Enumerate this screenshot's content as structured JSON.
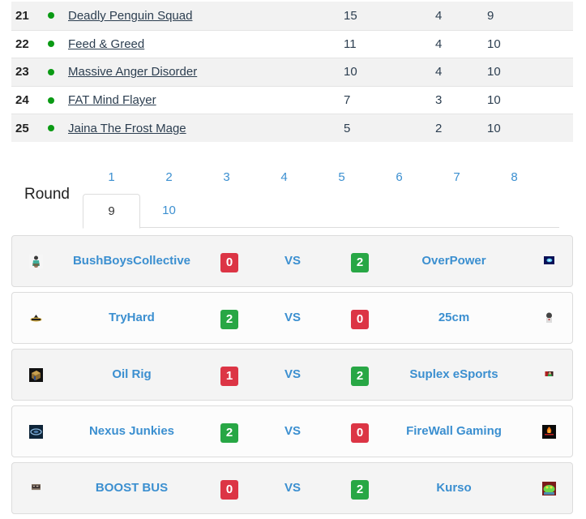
{
  "standings": {
    "rows": [
      {
        "rank": "21",
        "status": "active",
        "team": "Deadly Penguin Squad",
        "col1": "15",
        "col2": "4",
        "col3": "9"
      },
      {
        "rank": "22",
        "status": "active",
        "team": "Feed & Greed",
        "col1": "11",
        "col2": "4",
        "col3": "10"
      },
      {
        "rank": "23",
        "status": "active",
        "team": "Massive Anger Disorder",
        "col1": "10",
        "col2": "4",
        "col3": "10"
      },
      {
        "rank": "24",
        "status": "active",
        "team": "FAT Mind Flayer",
        "col1": "7",
        "col2": "3",
        "col3": "10"
      },
      {
        "rank": "25",
        "status": "active",
        "team": "Jaina The Frost Mage",
        "col1": "5",
        "col2": "2",
        "col3": "10"
      }
    ]
  },
  "rounds": {
    "label": "Round",
    "tabs": [
      "1",
      "2",
      "3",
      "4",
      "5",
      "6",
      "7",
      "8",
      "9",
      "10"
    ],
    "active": "9"
  },
  "matches": [
    {
      "home": "BushBoysCollective",
      "home_score": "0",
      "home_result": "loss",
      "home_logo": "bushboys-logo",
      "vs": "VS",
      "away": "OverPower",
      "away_score": "2",
      "away_result": "win",
      "away_logo": "overpower-logo"
    },
    {
      "home": "TryHard",
      "home_score": "2",
      "home_result": "win",
      "home_logo": "tryhard-logo",
      "vs": "VS",
      "away": "25cm",
      "away_score": "0",
      "away_result": "loss",
      "away_logo": "25cm-logo"
    },
    {
      "home": "Oil Rig",
      "home_score": "1",
      "home_result": "loss",
      "home_logo": "oilrig-logo",
      "vs": "VS",
      "away": "Suplex eSports",
      "away_score": "2",
      "away_result": "win",
      "away_logo": "suplex-logo"
    },
    {
      "home": "Nexus Junkies",
      "home_score": "2",
      "home_result": "win",
      "home_logo": "nexus-logo",
      "vs": "VS",
      "away": "FireWall Gaming",
      "away_score": "0",
      "away_result": "loss",
      "away_logo": "firewall-logo"
    },
    {
      "home": "BOOST BUS",
      "home_score": "0",
      "home_result": "loss",
      "home_logo": "boostbus-logo",
      "vs": "VS",
      "away": "Kurso",
      "away_score": "2",
      "away_result": "win",
      "away_logo": "kurso-logo"
    }
  ],
  "colors": {
    "win": "#28a745",
    "loss": "#dc3545",
    "link": "#3b8fd0",
    "status_dot": "#0a9a14"
  }
}
